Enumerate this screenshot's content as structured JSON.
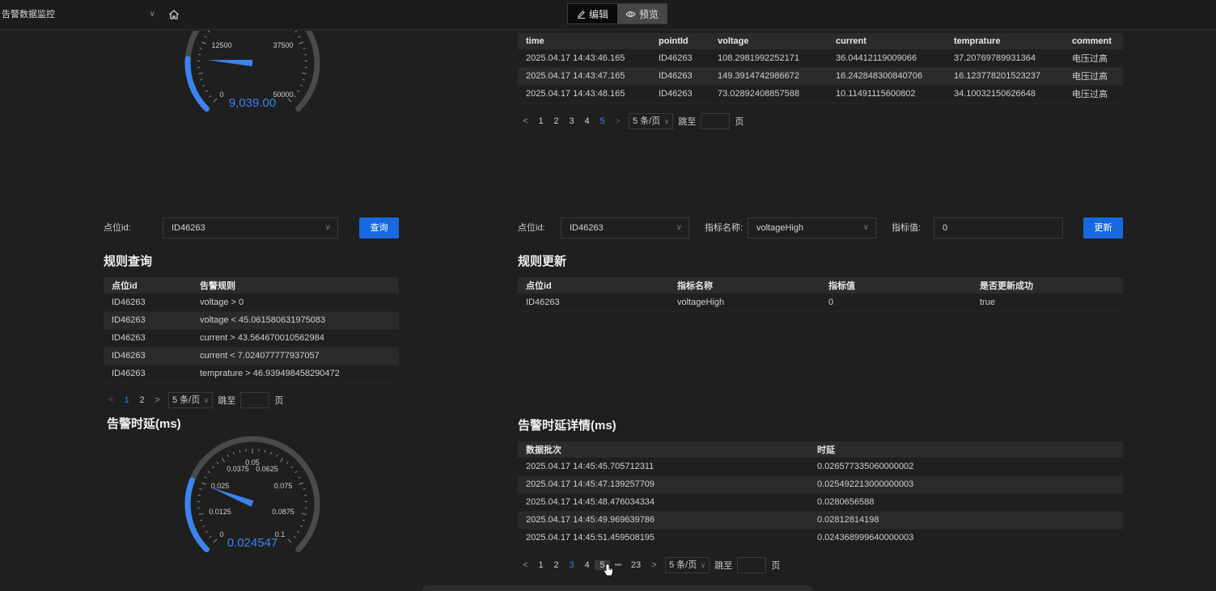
{
  "topbar": {
    "app_title": "告警数据监控",
    "edit_label": "编辑",
    "preview_label": "预览"
  },
  "colors": {
    "accent": "#3c83f0",
    "primary_button": "#1769e0",
    "gauge_track": "#4a4a4a"
  },
  "gauge_top": {
    "ticks": [
      "0",
      "12500",
      "37500",
      "50000"
    ],
    "value": 9039,
    "value_text": "9,039.00",
    "min": 0,
    "max": 50000
  },
  "alarm_table": {
    "columns": [
      "time",
      "pointId",
      "voltage",
      "current",
      "temprature",
      "comment"
    ],
    "rows": [
      [
        "2025.04.17 14:43:46.165",
        "ID46263",
        "108.2981992252171",
        "36.04412119009066",
        "37.20769789931364",
        "电压过高"
      ],
      [
        "2025.04.17 14:43:47.165",
        "ID46263",
        "149.3914742986672",
        "16.242848300840706",
        "16.123778201523237",
        "电压过高"
      ],
      [
        "2025.04.17 14:43:48.165",
        "ID46263",
        "73.02892408857588",
        "10.11491115600802",
        "34.10032150626648",
        "电压过高"
      ]
    ],
    "pager": {
      "pages": [
        "1",
        "2",
        "3",
        "4",
        "5"
      ],
      "current": "5",
      "size": "5 条/页",
      "jump_label": "跳至",
      "page_label": "页"
    }
  },
  "rule_query": {
    "point_label": "点位id:",
    "point_value": "ID46263",
    "query_button": "查询",
    "title": "规则查询",
    "columns": [
      "点位id",
      "告警规则"
    ],
    "rows": [
      [
        "ID46263",
        "voltage > 0"
      ],
      [
        "ID46263",
        "voltage < 45.061580631975083"
      ],
      [
        "ID46263",
        "current > 43.564670010562984"
      ],
      [
        "ID46263",
        "current < 7.024077777937057"
      ],
      [
        "ID46263",
        "temprature > 46.939498458290472"
      ]
    ],
    "pager": {
      "pages": [
        "1",
        "2"
      ],
      "current": "1",
      "size": "5 条/页",
      "jump_label": "跳至",
      "page_label": "页"
    }
  },
  "rule_update": {
    "point_label": "点位id:",
    "point_value": "ID46263",
    "metric_label": "指标名称:",
    "metric_value": "voltageHigh",
    "value_label": "指标值:",
    "value_input": "0",
    "update_button": "更新",
    "title": "规则更新",
    "columns": [
      "点位id",
      "指标名称",
      "指标值",
      "是否更新成功"
    ],
    "rows": [
      [
        "ID46263",
        "voltageHigh",
        "0",
        "true"
      ]
    ]
  },
  "delay_gauge": {
    "title": "告警时延(ms)",
    "ticks": [
      "0",
      "0.0125",
      "0.025",
      "0.0375",
      "0.05",
      "0.0625",
      "0.075",
      "0.0875",
      "0.1"
    ],
    "value": 0.024547,
    "value_text": "0.024547",
    "min": 0,
    "max": 0.1
  },
  "delay_detail": {
    "title": "告警时延详情(ms)",
    "columns": [
      "数据批次",
      "时延"
    ],
    "rows": [
      [
        "2025.04.17 14:45:45.705712311",
        "0.026577335060000002"
      ],
      [
        "2025.04.17 14:45:47.139257709",
        "0.025492213000000003"
      ],
      [
        "2025.04.17 14:45:48.476034334",
        "0.0280656588"
      ],
      [
        "2025.04.17 14:45:49.969639786",
        "0.02812814198"
      ],
      [
        "2025.04.17 14:45:51.459508195",
        "0.024368999640000003"
      ]
    ],
    "pager": {
      "pages": [
        "1",
        "2",
        "3",
        "4",
        "5"
      ],
      "ellipsis": "•••",
      "last": "23",
      "current": "3",
      "hover": "5",
      "size": "5 条/页",
      "jump_label": "跳至",
      "page_label": "页"
    }
  }
}
